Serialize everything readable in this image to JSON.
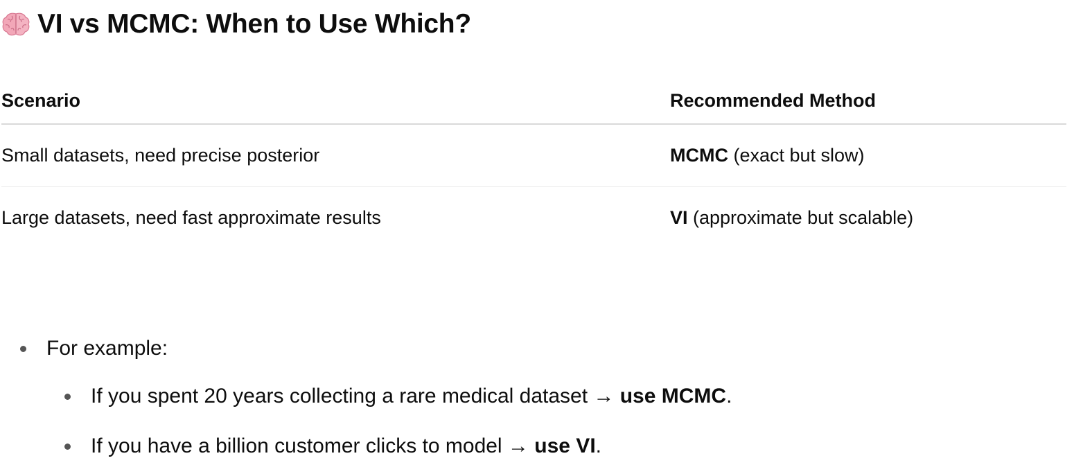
{
  "heading": {
    "icon": "brain-icon",
    "title": "VI vs MCMC: When to Use Which?"
  },
  "table": {
    "headers": [
      "Scenario",
      "Recommended Method"
    ],
    "rows": [
      {
        "scenario": "Small datasets, need precise posterior",
        "method_bold": "MCMC",
        "method_note": " (exact but slow)"
      },
      {
        "scenario": "Large datasets, need fast approximate results",
        "method_bold": "VI",
        "method_note": " (approximate but scalable)"
      }
    ]
  },
  "list": {
    "intro": "For example:",
    "items": [
      {
        "text": "If you spent 20 years collecting a rare medical dataset → ",
        "bold": "use MCMC",
        "end": "."
      },
      {
        "text": "If you have a billion customer clicks to model → ",
        "bold": "use VI",
        "end": "."
      }
    ]
  },
  "colors": {
    "text": "#0d0d0d",
    "bullet": "#555555",
    "header_rule": "#d9d9d9",
    "row_rule": "#ececec"
  }
}
